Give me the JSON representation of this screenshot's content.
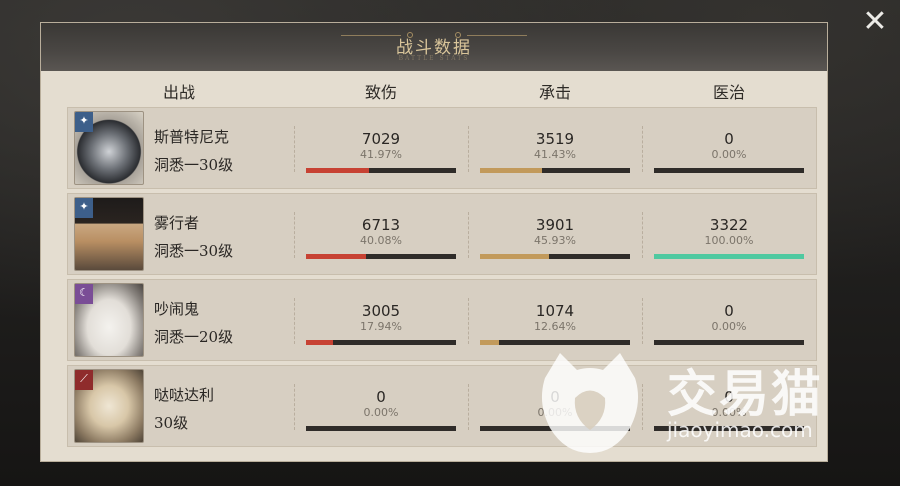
{
  "panel": {
    "title": "战斗数据",
    "subtitle": "BATTLE STATS",
    "close_label": "✕"
  },
  "columns": [
    "出战",
    "致伤",
    "承击",
    "医治"
  ],
  "rows": [
    {
      "name": "斯普特尼克",
      "level": "洞悉一30级",
      "badge": "✦",
      "badge_color": "#3d5f8a",
      "damage": {
        "value": "7029",
        "pct": "41.97%",
        "fraction": 0.4197
      },
      "taken": {
        "value": "3519",
        "pct": "41.43%",
        "fraction": 0.4143
      },
      "heal": {
        "value": "0",
        "pct": "0.00%",
        "fraction": 0
      }
    },
    {
      "name": "雾行者",
      "level": "洞悉一30级",
      "badge": "✦",
      "badge_color": "#3d5f8a",
      "damage": {
        "value": "6713",
        "pct": "40.08%",
        "fraction": 0.4008
      },
      "taken": {
        "value": "3901",
        "pct": "45.93%",
        "fraction": 0.4593
      },
      "heal": {
        "value": "3322",
        "pct": "100.00%",
        "fraction": 1.0
      }
    },
    {
      "name": "吵闹鬼",
      "level": "洞悉一20级",
      "badge": "☾",
      "badge_color": "#7a4d96",
      "damage": {
        "value": "3005",
        "pct": "17.94%",
        "fraction": 0.1794
      },
      "taken": {
        "value": "1074",
        "pct": "12.64%",
        "fraction": 0.1264
      },
      "heal": {
        "value": "0",
        "pct": "0.00%",
        "fraction": 0
      }
    },
    {
      "name": "哒哒达利",
      "level": "30级",
      "badge": "⟋",
      "badge_color": "#8f2c2c",
      "damage": {
        "value": "0",
        "pct": "0.00%",
        "fraction": 0
      },
      "taken": {
        "value": "0",
        "pct": "0.00%",
        "fraction": 0
      },
      "heal": {
        "value": "0",
        "pct": "0.00%",
        "fraction": 0
      }
    }
  ],
  "colors": {
    "damage_bar": "#c74233",
    "taken_bar": "#c29a5b",
    "heal_bar": "#4fc9a0"
  },
  "watermark": {
    "text": "交易猫",
    "url": "jiaoyimao.com"
  }
}
